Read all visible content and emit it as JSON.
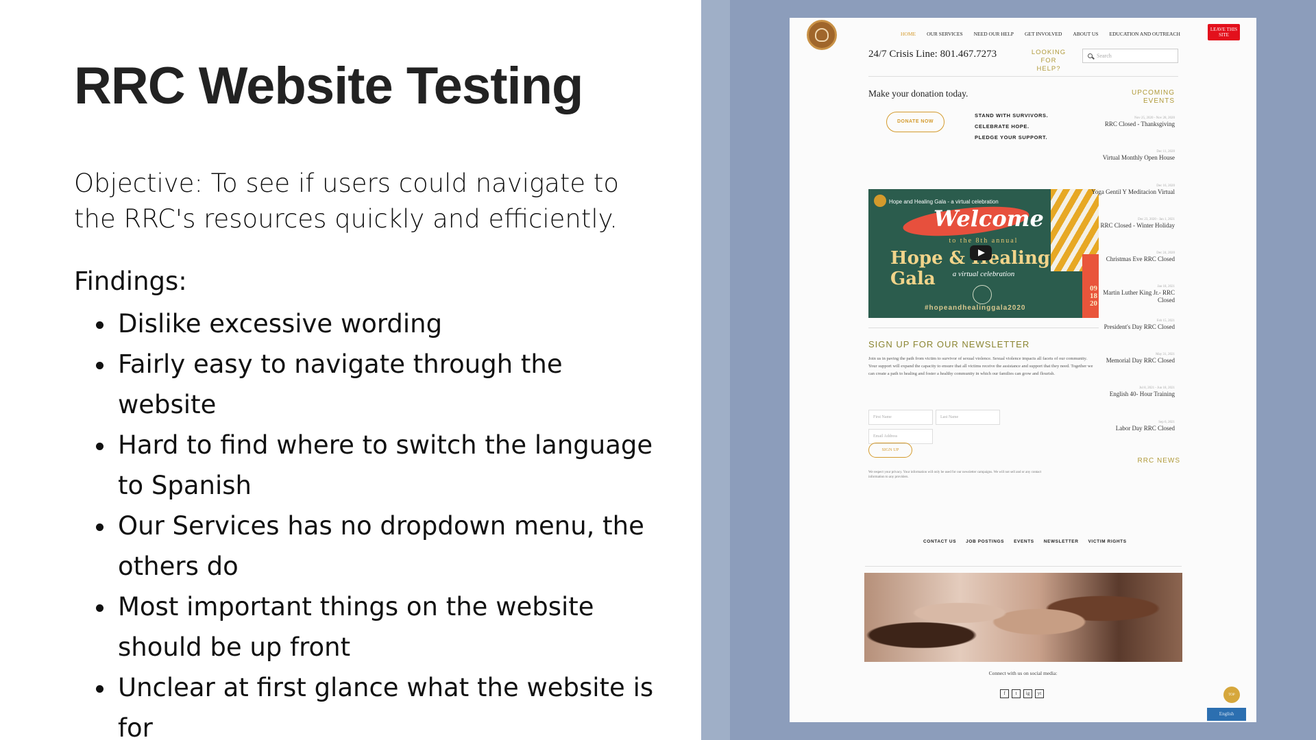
{
  "slide": {
    "title": "RRC Website Testing",
    "objective": "Objective: To see if users could navigate to the RRC's resources quickly and efficiently.",
    "findings_label": "Findings:",
    "findings": [
      "Dislike excessive wording",
      "Fairly easy to navigate through the website",
      "Hard to find where to switch the language to Spanish",
      "Our Services has no dropdown menu, the others do",
      "Most important things on the website should be up front",
      "Unclear at first glance what the website is for"
    ]
  },
  "website": {
    "nav": [
      "HOME",
      "OUR SERVICES",
      "NEED OUR HELP",
      "GET INVOLVED",
      "ABOUT US",
      "EDUCATION AND OUTREACH"
    ],
    "leave_button": "LEAVE THIS SITE",
    "crisis_line": "24/7 Crisis Line: 801.467.7273",
    "looking_for_help": "LOOKING FOR HELP?",
    "search_placeholder": "Search",
    "donation_text": "Make your donation today.",
    "donate_button": "DONATE NOW",
    "tagline": [
      "STAND WITH SURVIVORS.",
      "CELEBRATE HOPE.",
      "PLEDGE YOUR SUPPORT."
    ],
    "video": {
      "title": "Hope and Healing Gala - a virtual celebration",
      "welcome": "Welcome",
      "subtitle": "to the 8th annual",
      "gala": "Hope & Healing Gala",
      "virtual": "a virtual celebration",
      "hashtag": "#hopeandhealinggala2020",
      "date": [
        "09",
        "18",
        "20"
      ]
    },
    "newsletter": {
      "heading": "SIGN UP FOR OUR NEWSLETTER",
      "body": "Join us in paving the path from victim to survivor of sexual violence. Sexual violence impacts all facets of our community. Your support will expand the capacity to ensure that all victims receive the assistance and support that they need. Together we can create a path to healing and foster a healthy community in which our families can grow and flourish.",
      "first_name": "First Name",
      "last_name": "Last Name",
      "email": "Email Address",
      "button": "SIGN UP",
      "privacy": "We respect your privacy. Your information will only be used for our newsletter campaigns. We will not sell and or any contact information to any providers."
    },
    "events_heading": "UPCOMING EVENTS",
    "events": [
      {
        "date": "Nov 25, 2020 - Nov 28, 2020",
        "name": "RRC Closed - Thanksgiving"
      },
      {
        "date": "Dec 11, 2020",
        "name": "Virtual Monthly Open House"
      },
      {
        "date": "Dec 16, 2020",
        "name": "Yoga Gentil Y Meditacion Virtual"
      },
      {
        "date": "Dec 23, 2020 - Jan 1, 2021",
        "name": "RRC Closed - Winter Holiday"
      },
      {
        "date": "Dec 24, 2020",
        "name": "Christmas Eve RRC Closed"
      },
      {
        "date": "Jan 18, 2021",
        "name": "Martin Luther King Jr.- RRC Closed"
      },
      {
        "date": "Feb 15, 2021",
        "name": "President's Day RRC Closed"
      },
      {
        "date": "May 31, 2021",
        "name": "Memorial Day RRC Closed"
      },
      {
        "date": "Jul 8, 2021 - Jun 18, 2021",
        "name": "English 40- Hour Training"
      },
      {
        "date": "Sep 6, 2021",
        "name": "Labor Day RRC Closed"
      }
    ],
    "news_heading": "RRC NEWS",
    "footer_links": [
      "CONTACT US",
      "JOB POSTINGS",
      "EVENTS",
      "NEWSLETTER",
      "VICTIM RIGHTS"
    ],
    "connect_text": "Connect with us on social media:",
    "socials": [
      "f",
      "t",
      "ig",
      "yt"
    ],
    "top_button": "TOP",
    "language_button": "English"
  },
  "colors": {
    "accent_gold": "#d49a2c",
    "leave_red": "#e3101c",
    "panel_blue": "#8c9dbb",
    "video_green": "#2b5c4d"
  }
}
